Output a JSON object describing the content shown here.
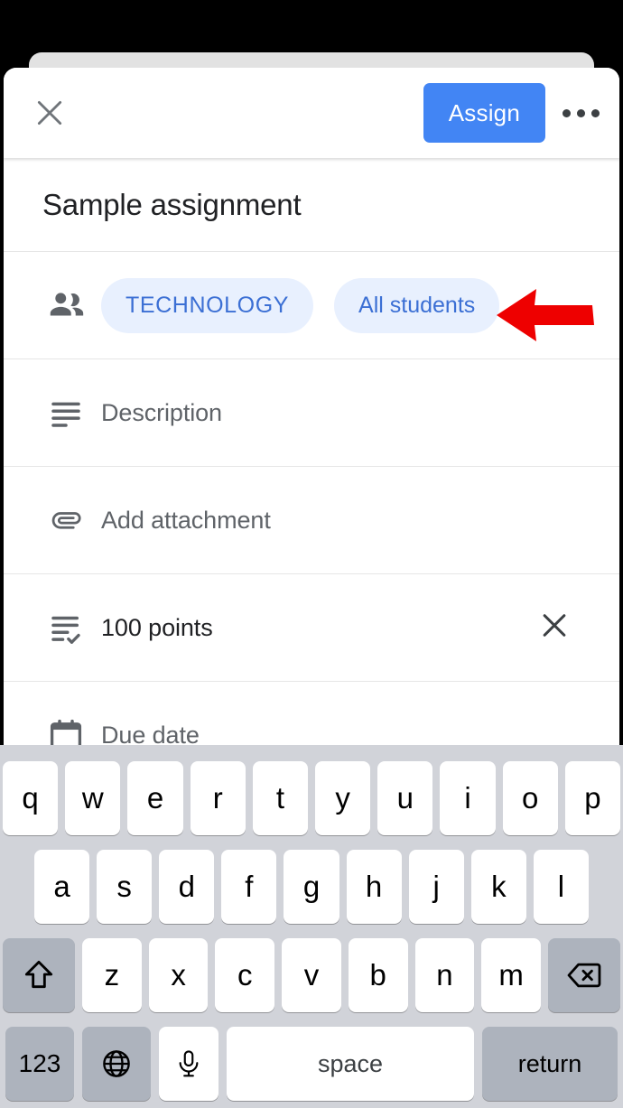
{
  "appbar": {
    "close_icon": "close-icon",
    "assign_label": "Assign",
    "more_icon": "more-options-icon"
  },
  "assignment": {
    "title": "Sample assignment",
    "audience": {
      "icon": "people-icon",
      "chips": [
        {
          "label": "TECHNOLOGY",
          "style": "uppercase"
        },
        {
          "label": "All students",
          "style": "normal"
        }
      ]
    },
    "rows": [
      {
        "icon": "description-icon",
        "label": "Description",
        "value": ""
      },
      {
        "icon": "attachment-icon",
        "label": "Add attachment",
        "value": ""
      },
      {
        "icon": "points-icon",
        "label": "100 points",
        "trailing_icon": "clear-icon"
      },
      {
        "icon": "calendar-icon",
        "label": "Due date",
        "value": ""
      }
    ]
  },
  "annotation": {
    "arrow_color": "#ee0000",
    "arrow_direction": "left",
    "points_at": "All students"
  },
  "colors": {
    "accent": "#4285f4",
    "chip_bg": "#e8f0fe",
    "chip_text": "#3b6fd4",
    "muted_text": "#5f6368",
    "keyboard_bg": "#d1d3d9",
    "key_fn_bg": "#adb3bd"
  },
  "keyboard": {
    "row1": [
      "q",
      "w",
      "e",
      "r",
      "t",
      "y",
      "u",
      "i",
      "o",
      "p"
    ],
    "row2": [
      "a",
      "s",
      "d",
      "f",
      "g",
      "h",
      "j",
      "k",
      "l"
    ],
    "row3": [
      "z",
      "x",
      "c",
      "v",
      "b",
      "n",
      "m"
    ],
    "shift_icon": "shift-icon",
    "backspace_icon": "backspace-icon",
    "numbers_label": "123",
    "globe_icon": "globe-icon",
    "mic_icon": "microphone-icon",
    "space_label": "space",
    "return_label": "return"
  }
}
